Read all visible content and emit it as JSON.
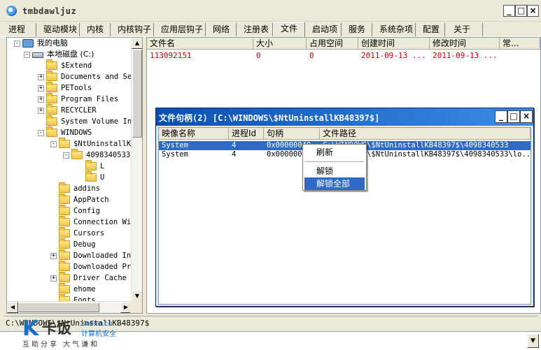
{
  "window": {
    "title": "tmbdawljuz",
    "min_glyph": "_",
    "max_glyph": "□",
    "close_glyph": "×"
  },
  "tabs": [
    {
      "label": "进程"
    },
    {
      "label": "驱动模块"
    },
    {
      "label": "内核"
    },
    {
      "label": "内核钩子"
    },
    {
      "label": "应用层钩子"
    },
    {
      "label": "网络"
    },
    {
      "label": "注册表"
    },
    {
      "label": "文件"
    },
    {
      "label": "启动项"
    },
    {
      "label": "服务"
    },
    {
      "label": "系统杂项"
    },
    {
      "label": "配置"
    },
    {
      "label": "关于"
    }
  ],
  "active_tab": "文件",
  "tree": {
    "items": [
      {
        "label": "我的电脑",
        "icon": "computer-icon",
        "expander": "-"
      },
      {
        "label": "本地磁盘 (C:)",
        "icon": "drive-icon",
        "expander": "-"
      },
      {
        "label": "$Extend",
        "icon": "folder-icon",
        "expander": ""
      },
      {
        "label": "Documents and Set",
        "icon": "folder-icon",
        "expander": "+"
      },
      {
        "label": "PETools",
        "icon": "folder-icon",
        "expander": "+"
      },
      {
        "label": "Program Files",
        "icon": "folder-icon",
        "expander": "+"
      },
      {
        "label": "RECYCLER",
        "icon": "folder-icon",
        "expander": "+"
      },
      {
        "label": "System Volume Inf",
        "icon": "folder-icon",
        "expander": ""
      },
      {
        "label": "WINDOWS",
        "icon": "folder-icon",
        "expander": "-"
      },
      {
        "label": "$NtUninstallKB",
        "icon": "folder-icon",
        "expander": "-"
      },
      {
        "label": "4098340533",
        "icon": "folder-icon",
        "expander": "-"
      },
      {
        "label": "L",
        "icon": "folder-icon",
        "expander": ""
      },
      {
        "label": "U",
        "icon": "folder-icon",
        "expander": ""
      },
      {
        "label": "addins",
        "icon": "folder-icon",
        "expander": ""
      },
      {
        "label": "AppPatch",
        "icon": "folder-icon",
        "expander": ""
      },
      {
        "label": "Config",
        "icon": "folder-icon",
        "expander": ""
      },
      {
        "label": "Connection Wiz",
        "icon": "folder-icon",
        "expander": ""
      },
      {
        "label": "Cursors",
        "icon": "folder-icon",
        "expander": ""
      },
      {
        "label": "Debug",
        "icon": "folder-icon",
        "expander": ""
      },
      {
        "label": "Downloaded Ins",
        "icon": "folder-icon",
        "expander": "+"
      },
      {
        "label": "Downloaded Pro",
        "icon": "folder-icon",
        "expander": ""
      },
      {
        "label": "Driver Cache",
        "icon": "folder-icon",
        "expander": "+"
      },
      {
        "label": "ehome",
        "icon": "folder-icon",
        "expander": ""
      },
      {
        "label": "Fonts",
        "icon": "folder-icon",
        "expander": ""
      }
    ]
  },
  "file_list": {
    "columns": [
      "文件名",
      "大小",
      "占用空间",
      "创建时间",
      "修改时间",
      "常..."
    ],
    "rows": [
      [
        "113092151",
        "0",
        "0",
        "2011-09-13 ...",
        "2011-09-13 ...",
        ""
      ]
    ]
  },
  "modal": {
    "title": "文件句柄(2)  [C:\\WINDOWS\\$NtUninstallKB48397$]",
    "columns": [
      "映像名称",
      "进程Id",
      "句柄",
      "文件路径"
    ],
    "rows": [
      [
        "System",
        "4",
        "0x00000040",
        "C:\\WINDOWS\\$NtUninstallKB48397$\\4098340533"
      ],
      [
        "System",
        "4",
        "0x00000054",
        "C:\\WINDOWS\\$NtUninstallKB48397$\\4098340533\\lo..."
      ]
    ]
  },
  "context_menu": {
    "items": [
      "刷新",
      "解锁",
      "解锁全部"
    ]
  },
  "status": {
    "path": "C:\\WINDOWS\\$NtUninstallKB48397$"
  },
  "watermark": {
    "brand_k": "K",
    "brand_cn": "卡饭",
    "sub_en": "KaFan.cn",
    "sub_cn": "计算机安全",
    "slogan": "互助分享  大气谦和"
  },
  "colors": {
    "accent_blue": "#316ac5",
    "file_row_text": "#cc0000",
    "modal_title_start": "#0a4fb0"
  }
}
